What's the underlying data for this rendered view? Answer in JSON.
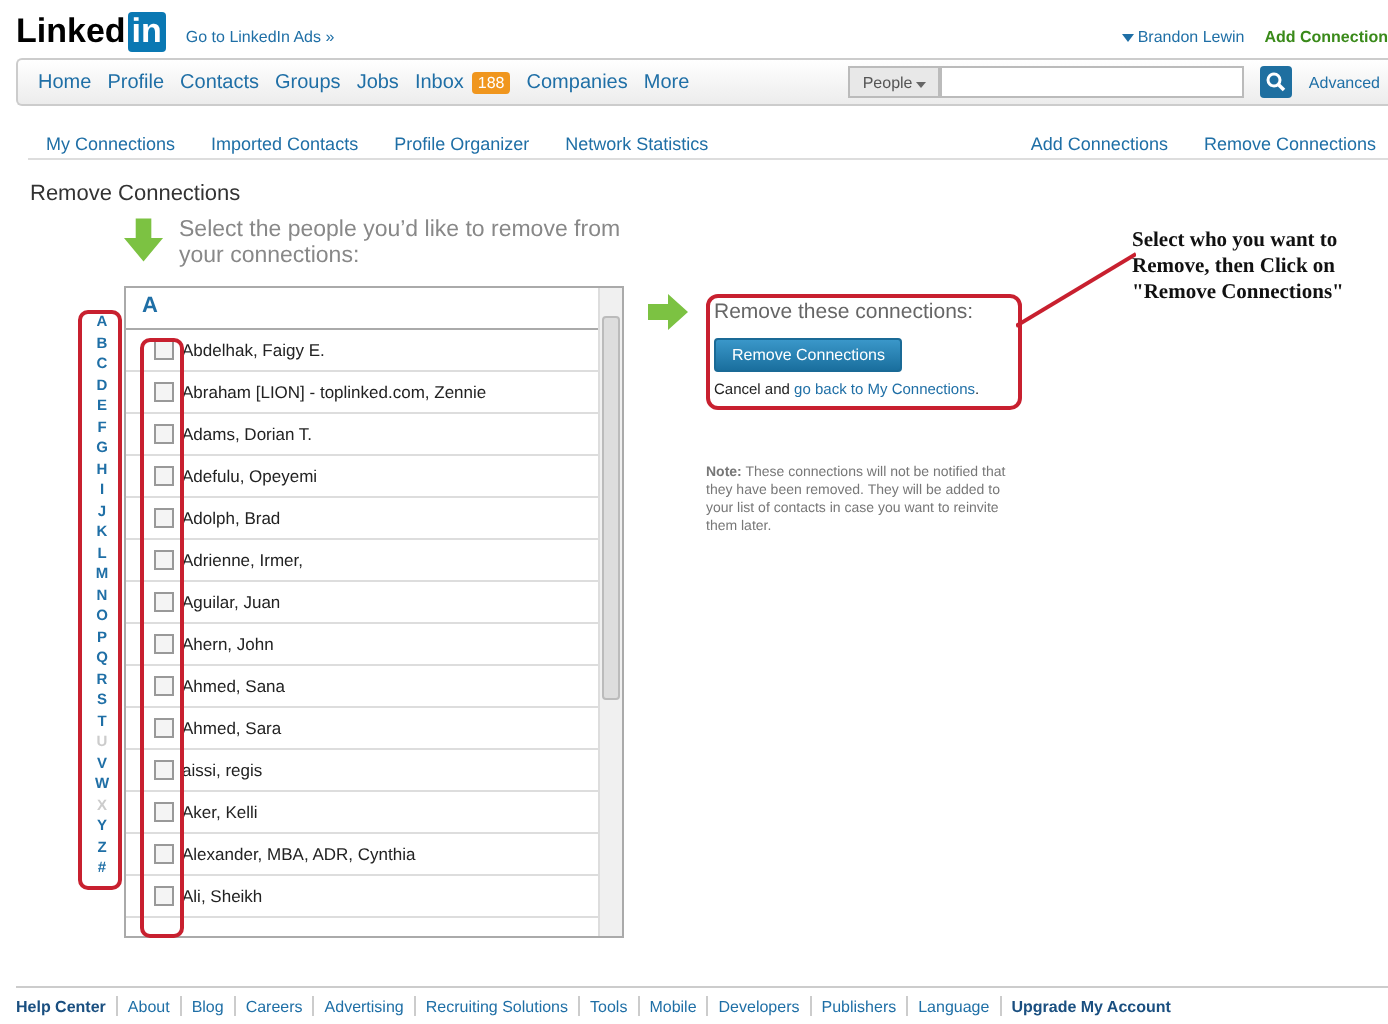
{
  "header": {
    "logo_word": "Linked",
    "logo_box": "in",
    "ads_link": "Go to LinkedIn Ads »",
    "user_menu": "Brandon Lewin",
    "add_link": "Add Connection"
  },
  "nav": {
    "items": [
      {
        "label": "Home"
      },
      {
        "label": "Profile"
      },
      {
        "label": "Contacts"
      },
      {
        "label": "Groups"
      },
      {
        "label": "Jobs"
      },
      {
        "label": "Inbox",
        "badge": "188"
      },
      {
        "label": "Companies"
      },
      {
        "label": "More"
      }
    ],
    "search": {
      "scope": "People",
      "advanced": "Advanced"
    }
  },
  "subnav": {
    "left": [
      "My Connections",
      "Imported Contacts",
      "Profile Organizer",
      "Network Statistics"
    ],
    "right": [
      "Add Connections",
      "Remove Connections"
    ]
  },
  "page_title": "Remove Connections",
  "instruction": "Select the people you’d like to remove from your connections:",
  "alphabet": [
    {
      "letter": "A",
      "disabled": false
    },
    {
      "letter": "B",
      "disabled": false
    },
    {
      "letter": "C",
      "disabled": false
    },
    {
      "letter": "D",
      "disabled": false
    },
    {
      "letter": "E",
      "disabled": false
    },
    {
      "letter": "F",
      "disabled": false
    },
    {
      "letter": "G",
      "disabled": false
    },
    {
      "letter": "H",
      "disabled": false
    },
    {
      "letter": "I",
      "disabled": false
    },
    {
      "letter": "J",
      "disabled": false
    },
    {
      "letter": "K",
      "disabled": false
    },
    {
      "letter": "L",
      "disabled": false
    },
    {
      "letter": "M",
      "disabled": false
    },
    {
      "letter": "N",
      "disabled": false
    },
    {
      "letter": "O",
      "disabled": false
    },
    {
      "letter": "P",
      "disabled": false
    },
    {
      "letter": "Q",
      "disabled": false
    },
    {
      "letter": "R",
      "disabled": false
    },
    {
      "letter": "S",
      "disabled": false
    },
    {
      "letter": "T",
      "disabled": false
    },
    {
      "letter": "U",
      "disabled": true
    },
    {
      "letter": "V",
      "disabled": false
    },
    {
      "letter": "W",
      "disabled": false
    },
    {
      "letter": "X",
      "disabled": true
    },
    {
      "letter": "Y",
      "disabled": false
    },
    {
      "letter": "Z",
      "disabled": false
    },
    {
      "letter": "#",
      "disabled": false
    }
  ],
  "list": {
    "heading": "A",
    "rows": [
      {
        "name": "Abdelhak, Faigy E.",
        "checked": false
      },
      {
        "name": "Abraham [LION] - toplinked.com, Zennie",
        "checked": false
      },
      {
        "name": "Adams, Dorian T.",
        "checked": false
      },
      {
        "name": "Adefulu, Opeyemi",
        "checked": false
      },
      {
        "name": "Adolph, Brad",
        "checked": false
      },
      {
        "name": "Adrienne, Irmer,",
        "checked": false
      },
      {
        "name": "Aguilar, Juan",
        "checked": false
      },
      {
        "name": "Ahern, John",
        "checked": false
      },
      {
        "name": "Ahmed, Sana",
        "checked": false
      },
      {
        "name": "Ahmed, Sara",
        "checked": false
      },
      {
        "name": "aissi, regis",
        "checked": false
      },
      {
        "name": "Aker, Kelli",
        "checked": false
      },
      {
        "name": "Alexander, MBA, ADR, Cynthia",
        "checked": false
      },
      {
        "name": "Ali, Sheikh",
        "checked": false
      }
    ]
  },
  "remove_panel": {
    "title": "Remove these connections:",
    "button": "Remove Connections",
    "cancel_text": "Cancel and",
    "cancel_link": "go back to My Connections",
    "cancel_end": ".",
    "note_label": "Note:",
    "note": "These connections will not be notified that they have been removed. They will be added to your list of contacts in case you want to reinvite them later."
  },
  "annotation": "Select who you want to Remove, then Click on \"Remove Connections\"",
  "footer": [
    {
      "label": "Help Center",
      "bold": true
    },
    {
      "label": "About",
      "bold": false
    },
    {
      "label": "Blog",
      "bold": false
    },
    {
      "label": "Careers",
      "bold": false
    },
    {
      "label": "Advertising",
      "bold": false
    },
    {
      "label": "Recruiting Solutions",
      "bold": false
    },
    {
      "label": "Tools",
      "bold": false
    },
    {
      "label": "Mobile",
      "bold": false
    },
    {
      "label": "Developers",
      "bold": false
    },
    {
      "label": "Publishers",
      "bold": false
    },
    {
      "label": "Language",
      "bold": false
    },
    {
      "label": "Upgrade My Account",
      "bold": true
    }
  ]
}
